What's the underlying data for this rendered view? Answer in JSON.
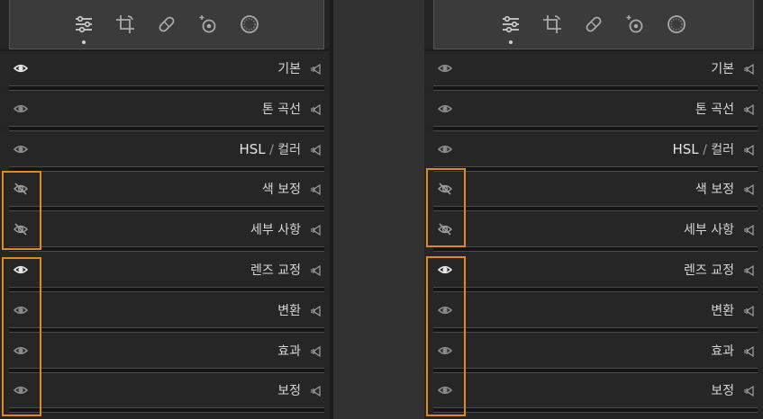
{
  "colors": {
    "panel": "#252525",
    "toolstrip": "#3b3b3b",
    "highlight": "#e08a1e",
    "text": "#d6d6d6",
    "icon": "#bdbdbd"
  },
  "toolstrip": {
    "icons": [
      "edit-sliders-icon",
      "crop-rotate-icon",
      "healing-bandage-icon",
      "red-eye-icon",
      "masking-icon"
    ]
  },
  "panels": {
    "left": {
      "sections": [
        {
          "label": "기본",
          "eye": "visible"
        },
        {
          "label": "톤 곡선",
          "eye": "visible-dim"
        },
        {
          "label_a": "HSL",
          "label_sep": "/",
          "label_b": "컬러",
          "eye": "visible-dim"
        },
        {
          "label": "색 보정",
          "eye": "hidden"
        },
        {
          "label": "세부 사항",
          "eye": "hidden"
        },
        {
          "label": "렌즈 교정",
          "eye": "visible"
        },
        {
          "label": "변환",
          "eye": "visible-dim"
        },
        {
          "label": "효과",
          "eye": "visible-dim"
        },
        {
          "label": "보정",
          "eye": "visible-dim"
        }
      ]
    },
    "right": {
      "sections": [
        {
          "label": "기본",
          "eye": "visible-dim"
        },
        {
          "label": "톤 곡선",
          "eye": "visible-dim"
        },
        {
          "label_a": "HSL",
          "label_sep": "/",
          "label_b": "컬러",
          "eye": "visible-dim"
        },
        {
          "label": "색 보정",
          "eye": "hidden"
        },
        {
          "label": "세부 사항",
          "eye": "hidden"
        },
        {
          "label": "렌즈 교정",
          "eye": "visible"
        },
        {
          "label": "변환",
          "eye": "visible-dim"
        },
        {
          "label": "효과",
          "eye": "visible-dim"
        },
        {
          "label": "보정",
          "eye": "visible-dim"
        }
      ]
    }
  }
}
